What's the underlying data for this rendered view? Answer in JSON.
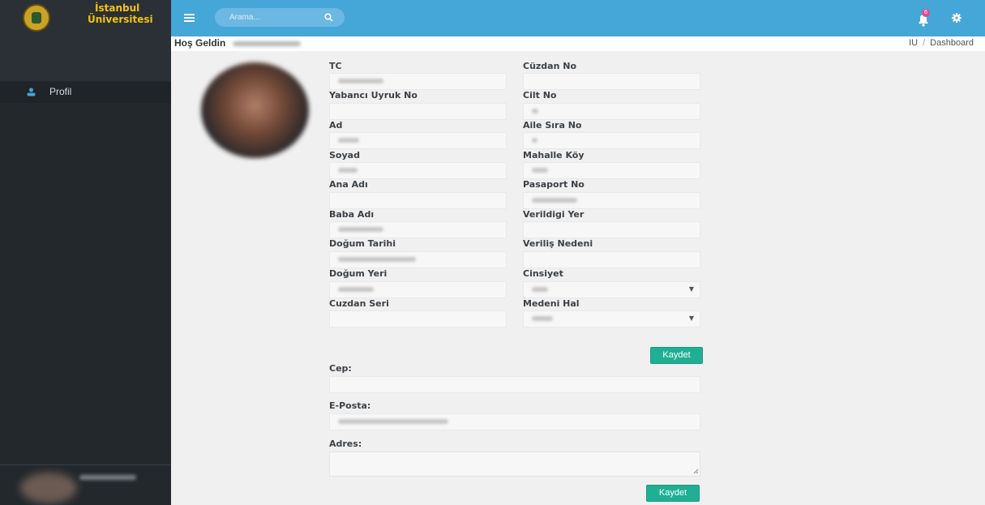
{
  "brand": {
    "line1": "İstanbul",
    "line2": "Üniversitesi"
  },
  "topbar": {
    "search_placeholder": "Arama...",
    "notification_count": "6"
  },
  "sidebar": {
    "items": [
      {
        "label": "Profil",
        "icon": "user-icon"
      }
    ]
  },
  "header": {
    "welcome": "Hoş Geldin"
  },
  "breadcrumb": {
    "items": [
      "IU",
      "Dashboard"
    ],
    "separator": "/"
  },
  "form": {
    "left": [
      {
        "label": "TC"
      },
      {
        "label": "Yabancı Uyruk No"
      },
      {
        "label": "Ad"
      },
      {
        "label": "Soyad"
      },
      {
        "label": "Ana Adı"
      },
      {
        "label": "Baba Adı"
      },
      {
        "label": "Doğum Tarihi"
      },
      {
        "label": "Doğum Yeri"
      },
      {
        "label": "Cuzdan Seri"
      }
    ],
    "right": [
      {
        "label": "Cüzdan No"
      },
      {
        "label": "Cilt No"
      },
      {
        "label": "Aile Sıra No"
      },
      {
        "label": "Mahalle Köy"
      },
      {
        "label": "Pasaport No"
      },
      {
        "label": "Verildigi Yer"
      },
      {
        "label": "Veriliş Nedeni"
      },
      {
        "label": "Cinsiyet"
      },
      {
        "label": "Medeni Hal"
      }
    ],
    "save_label": "Kaydet"
  },
  "contact": {
    "cep_label": "Cep:",
    "email_label": "E-Posta:",
    "adres_label": "Adres:",
    "save_label": "Kaydet"
  },
  "colors": {
    "topbar": "#45a6d8",
    "sidebar": "#23282c",
    "brand_text": "#f3c30b",
    "button": "#1faf93"
  }
}
